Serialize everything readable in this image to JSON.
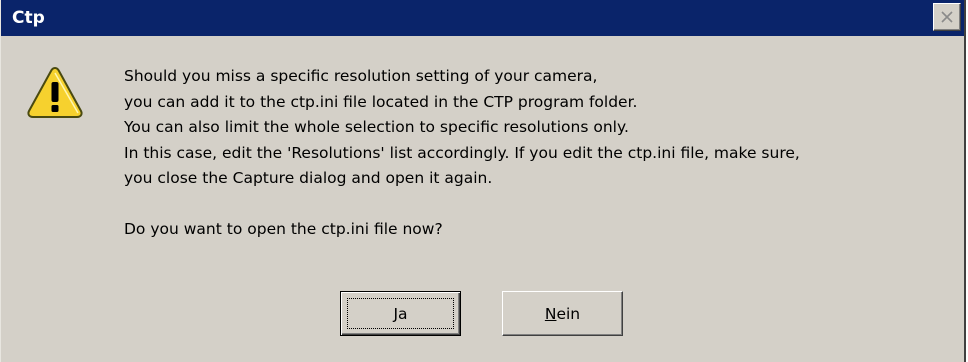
{
  "window": {
    "title": "Ctp",
    "close_icon": "close-icon"
  },
  "colors": {
    "titlebar": "#0a246a",
    "dialog_bg": "#d4d0c8",
    "warning_yellow": "#f6d12e"
  },
  "message": {
    "icon": "warning-icon",
    "lines": [
      "Should you miss a specific resolution setting of your camera,",
      "you can add it to the ctp.ini file located in the CTP program folder.",
      "You can also limit the whole selection to specific resolutions only.",
      "In this case, edit the 'Resolutions' list accordingly. If you edit the ctp.ini file, make sure,",
      "you close the Capture dialog and open it again."
    ],
    "question": "Do you want to open the ctp.ini file now?"
  },
  "buttons": {
    "yes": {
      "mnemonic": "J",
      "rest": "a"
    },
    "no": {
      "mnemonic": "N",
      "rest": "ein"
    }
  }
}
